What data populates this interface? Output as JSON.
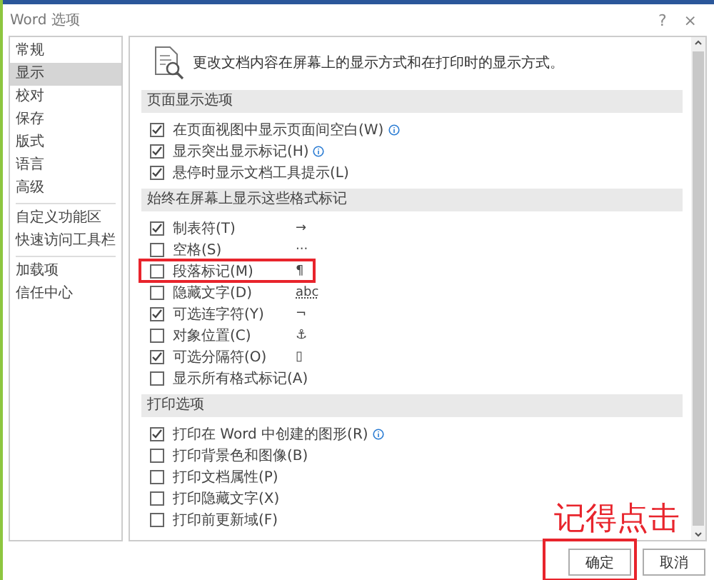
{
  "window": {
    "title": "Word 选项",
    "help": "?",
    "close": "×"
  },
  "sidebar": {
    "groups": [
      {
        "items": [
          {
            "label": "常规",
            "selected": false
          },
          {
            "label": "显示",
            "selected": true
          },
          {
            "label": "校对",
            "selected": false
          },
          {
            "label": "保存",
            "selected": false
          },
          {
            "label": "版式",
            "selected": false
          },
          {
            "label": "语言",
            "selected": false
          },
          {
            "label": "高级",
            "selected": false
          }
        ]
      },
      {
        "items": [
          {
            "label": "自定义功能区",
            "selected": false
          },
          {
            "label": "快速访问工具栏",
            "selected": false
          }
        ]
      },
      {
        "items": [
          {
            "label": "加载项",
            "selected": false
          },
          {
            "label": "信任中心",
            "selected": false
          }
        ]
      }
    ]
  },
  "intro": "更改文档内容在屏幕上的显示方式和在打印时的显示方式。",
  "sections": [
    {
      "title": "页面显示选项",
      "items": [
        {
          "label": "在页面视图中显示页面间空白(W)",
          "checked": true,
          "info": true
        },
        {
          "label": "显示突出显示标记(H)",
          "checked": true,
          "info": true
        },
        {
          "label": "悬停时显示文档工具提示(L)",
          "checked": true
        }
      ]
    },
    {
      "title": "始终在屏幕上显示这些格式标记",
      "items": [
        {
          "label": "制表符(T)",
          "checked": true,
          "symbol": "→"
        },
        {
          "label": "空格(S)",
          "checked": false,
          "symbol": "···"
        },
        {
          "label": "段落标记(M)",
          "checked": false,
          "symbol": "¶",
          "highlighted": true
        },
        {
          "label": "隐藏文字(D)",
          "checked": false,
          "symbol": "abc"
        },
        {
          "label": "可选连字符(Y)",
          "checked": true,
          "symbol": "¬"
        },
        {
          "label": "对象位置(C)",
          "checked": false,
          "symbol": "⚓"
        },
        {
          "label": "可选分隔符(O)",
          "checked": true,
          "symbol": "▯"
        },
        {
          "label": "显示所有格式标记(A)",
          "checked": false
        }
      ]
    },
    {
      "title": "打印选项",
      "items": [
        {
          "label": "打印在 Word 中创建的图形(R)",
          "checked": true,
          "info": true
        },
        {
          "label": "打印背景色和图像(B)",
          "checked": false
        },
        {
          "label": "打印文档属性(P)",
          "checked": false
        },
        {
          "label": "打印隐藏文字(X)",
          "checked": false
        },
        {
          "label": "打印前更新域(F)",
          "checked": false
        }
      ]
    }
  ],
  "buttons": [
    {
      "label": "确定",
      "highlighted": true
    },
    {
      "label": "取消"
    }
  ],
  "annotation": {
    "text": "记得点击"
  }
}
